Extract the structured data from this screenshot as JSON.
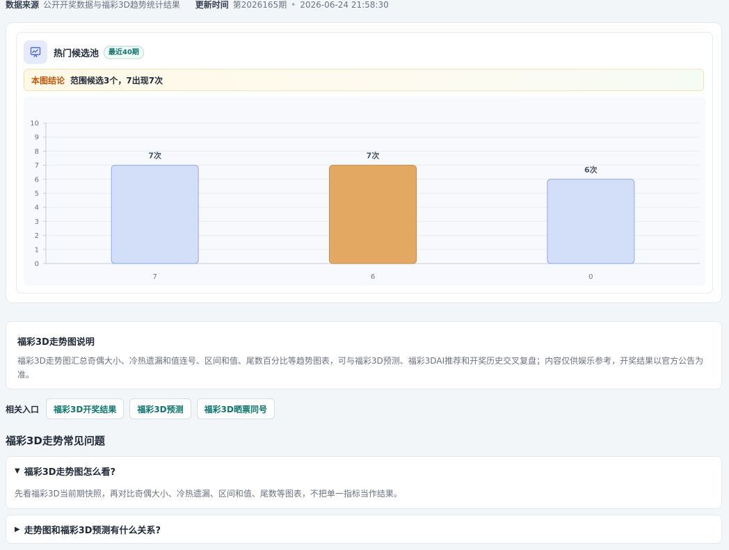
{
  "meta": {
    "source_label": "数据来源",
    "source_value": "公开开奖数据与福彩3D趋势统计结果",
    "update_label": "更新时间",
    "issue": "第2026165期",
    "datetime": "2026-06-24 21:58:30"
  },
  "panel": {
    "title": "热门候选池",
    "badge": "最近40期",
    "icon": "chart-icon",
    "conclusion_tag": "本图结论",
    "conclusion_text": "范围候选3个，7出现7次"
  },
  "chart_data": {
    "type": "bar",
    "categories": [
      "7",
      "6",
      "0"
    ],
    "values": [
      7,
      7,
      6
    ],
    "labels": [
      "7次",
      "7次",
      "6次"
    ],
    "highlight_index": 1,
    "ylim": [
      0,
      10
    ],
    "yticks": [
      "0",
      "1",
      "2",
      "3",
      "4",
      "5",
      "6",
      "7",
      "8",
      "9",
      "10"
    ],
    "colors": {
      "bar": "#d3def8",
      "bar_border": "#8ea7e6",
      "highlight": "#e3a862",
      "highlight_border": "#c98a46"
    }
  },
  "description": {
    "title": "福彩3D走势图说明",
    "body": "福彩3D走势图汇总奇偶大小、冷热遗漏和值连号、区间和值、尾数百分比等趋势图表，可与福彩3D预测、福彩3DAI推荐和开奖历史交叉复盘；内容仅供娱乐参考，开奖结果以官方公告为准。"
  },
  "related": {
    "label": "相关入口",
    "links": [
      "福彩3D开奖结果",
      "福彩3D预测",
      "福彩3D晒票同号"
    ]
  },
  "faq": {
    "title": "福彩3D走势常见问题",
    "items": [
      {
        "marker": "▼",
        "q": "福彩3D走势图怎么看?",
        "a": "先看福彩3D当前期快照，再对比奇偶大小、冷热遗漏、区间和值、尾数等图表，不把单一指标当作结果。"
      },
      {
        "marker": "▶",
        "q": "走势图和福彩3D预测有什么关系?"
      }
    ]
  }
}
